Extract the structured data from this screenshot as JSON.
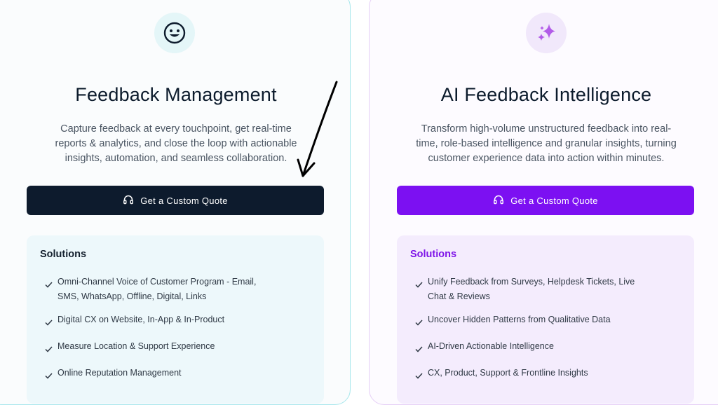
{
  "cards": [
    {
      "icon": "smiley-face-icon",
      "title": "Feedback Management",
      "description": "Capture feedback at every touchpoint, get real-time reports & analytics, and close the loop with actionable insights, automation, and seamless collaboration.",
      "cta_label": "Get a Custom Quote",
      "cta_icon": "headset-icon",
      "solutions_title": "Solutions",
      "solutions": [
        "Omni-Channel Voice of Customer Program - Email, SMS, WhatsApp, Offline, Digital, Links",
        "Digital CX on Website, In-App & In-Product",
        "Measure Location & Support Experience",
        "Online Reputation Management"
      ]
    },
    {
      "icon": "sparkles-icon",
      "title": "AI Feedback Intelligence",
      "description": "Transform high-volume unstructured feedback into real-time, role-based intelligence and granular insights, turning customer experience data into action within minutes.",
      "cta_label": "Get a Custom Quote",
      "cta_icon": "headset-icon",
      "solutions_title": "Solutions",
      "solutions": [
        "Unify Feedback from Surveys, Helpdesk Tickets, Live Chat & Reviews",
        "Uncover Hidden Patterns from Qualitative Data",
        "AI-Driven Actionable Intelligence",
        "CX, Product, Support & Frontline Insights"
      ]
    }
  ],
  "colors": {
    "left_border": "#a7e7ec",
    "right_border": "#e5cff6",
    "left_button": "#0d1b2d",
    "right_button": "#7c10f2",
    "right_accent": "#7e13e8"
  }
}
